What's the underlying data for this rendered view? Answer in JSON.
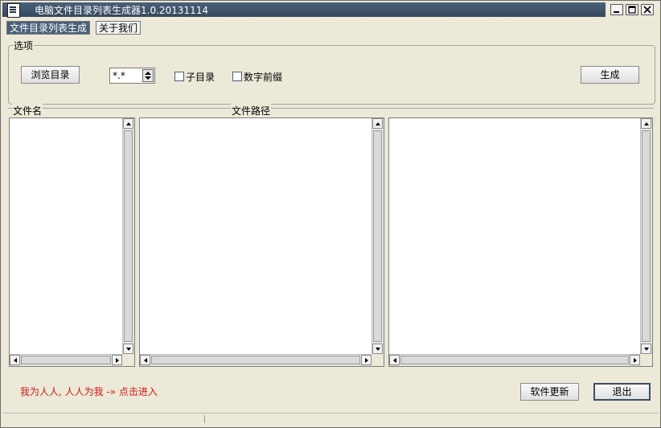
{
  "window": {
    "title": "电脑文件目录列表生成器1.0.20131114",
    "icon": "app-document-icon",
    "controls": [
      "minimize-icon",
      "maximize-icon",
      "close-icon"
    ]
  },
  "tabs": [
    {
      "label": "文件目录列表生成",
      "active": true
    },
    {
      "label": "关于我们",
      "active": false
    }
  ],
  "options": {
    "group_title": "选项",
    "browse_button": "浏览目录",
    "pattern_value": "*.*",
    "subdir_label": "子目录",
    "subdir_checked": false,
    "number_prefix_label": "数字前缀",
    "number_prefix_checked": false,
    "generate_button": "生成"
  },
  "lists": {
    "filename_header": "文件名",
    "filepath_header": "文件路径",
    "filename_items": [],
    "filepath_items": [],
    "third_items": []
  },
  "footer": {
    "promo_text": "我为人人, 人人为我 -» 点击进入",
    "update_button": "软件更新",
    "exit_button": "退出"
  },
  "colors": {
    "title_bar": "#4a6079",
    "background": "#ece9d8",
    "promo": "#d21a1a"
  }
}
